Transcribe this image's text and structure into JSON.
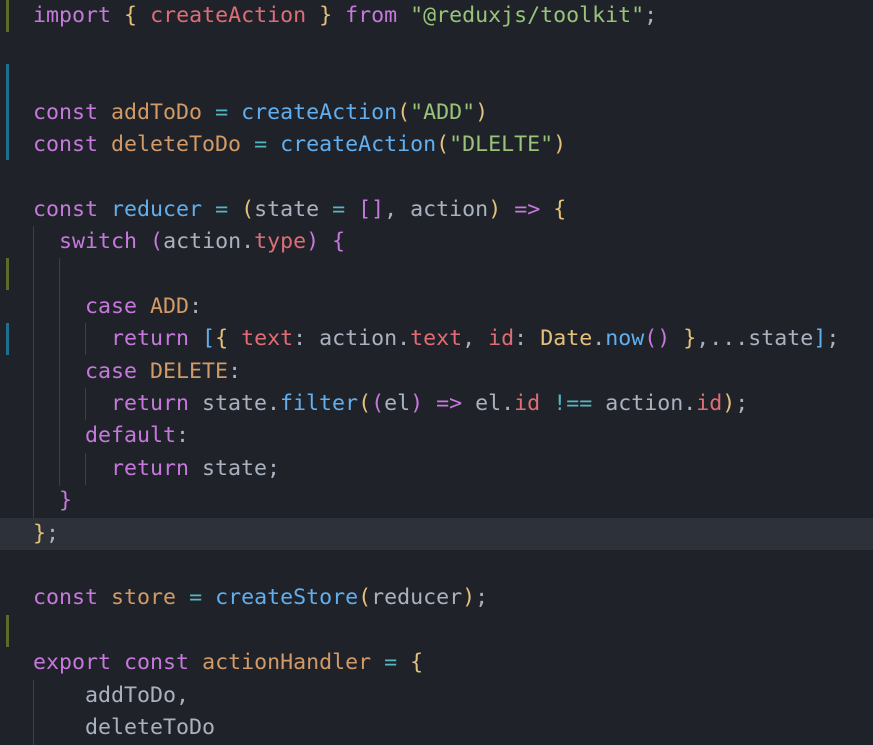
{
  "editor": {
    "language": "javascript",
    "colors": {
      "background": "#1f2329",
      "current_line": "#2c313a",
      "gutter_modified": "#5b6b2a",
      "gutter_added": "#1e6e8c",
      "keyword": "#c678dd",
      "function": "#61afef",
      "string": "#98c379",
      "variable": "#d19a66",
      "property": "#e06c75",
      "punctuation": "#abb2bf"
    },
    "lines": [
      [
        [
          "k",
          "import"
        ],
        [
          "p",
          " "
        ],
        [
          "b",
          "{"
        ],
        [
          "p",
          " "
        ],
        [
          "i",
          "createAction"
        ],
        [
          "p",
          " "
        ],
        [
          "b",
          "}"
        ],
        [
          "p",
          " "
        ],
        [
          "k",
          "from"
        ],
        [
          "p",
          " "
        ],
        [
          "s",
          "\"@reduxjs/toolkit\""
        ],
        [
          "p",
          ";"
        ]
      ],
      [],
      [],
      [
        [
          "k",
          "const"
        ],
        [
          "p",
          " "
        ],
        [
          "var",
          "addToDo"
        ],
        [
          "p",
          " "
        ],
        [
          "o",
          "="
        ],
        [
          "p",
          " "
        ],
        [
          "f",
          "createAction"
        ],
        [
          "b",
          "("
        ],
        [
          "s",
          "\"ADD\""
        ],
        [
          "b",
          ")"
        ]
      ],
      [
        [
          "k",
          "const"
        ],
        [
          "p",
          " "
        ],
        [
          "var",
          "deleteToDo"
        ],
        [
          "p",
          " "
        ],
        [
          "o",
          "="
        ],
        [
          "p",
          " "
        ],
        [
          "f",
          "createAction"
        ],
        [
          "b",
          "("
        ],
        [
          "s",
          "\"DLELTE\""
        ],
        [
          "b",
          ")"
        ]
      ],
      [],
      [
        [
          "k",
          "const"
        ],
        [
          "p",
          " "
        ],
        [
          "f",
          "reducer"
        ],
        [
          "p",
          " "
        ],
        [
          "o",
          "="
        ],
        [
          "p",
          " "
        ],
        [
          "b",
          "("
        ],
        [
          "p",
          "state "
        ],
        [
          "o",
          "="
        ],
        [
          "p",
          " "
        ],
        [
          "k",
          "[]"
        ],
        [
          "p",
          ", action"
        ],
        [
          "b",
          ")"
        ],
        [
          "p",
          " "
        ],
        [
          "k",
          "=>"
        ],
        [
          "p",
          " "
        ],
        [
          "b",
          "{"
        ]
      ],
      [
        [
          "p",
          "  "
        ],
        [
          "k",
          "switch"
        ],
        [
          "p",
          " "
        ],
        [
          "k",
          "("
        ],
        [
          "p",
          "action."
        ],
        [
          "i",
          "type"
        ],
        [
          "k",
          ")"
        ],
        [
          "p",
          " "
        ],
        [
          "k",
          "{"
        ]
      ],
      [],
      [
        [
          "p",
          "    "
        ],
        [
          "k",
          "case"
        ],
        [
          "p",
          " "
        ],
        [
          "var",
          "ADD"
        ],
        [
          "p",
          ":"
        ]
      ],
      [
        [
          "p",
          "      "
        ],
        [
          "k",
          "return"
        ],
        [
          "p",
          " "
        ],
        [
          "f",
          "["
        ],
        [
          "b",
          "{"
        ],
        [
          "p",
          " "
        ],
        [
          "i",
          "text"
        ],
        [
          "p",
          ": action."
        ],
        [
          "i",
          "text"
        ],
        [
          "p",
          ", "
        ],
        [
          "i",
          "id"
        ],
        [
          "p",
          ": "
        ],
        [
          "t",
          "Date"
        ],
        [
          "p",
          "."
        ],
        [
          "f",
          "now"
        ],
        [
          "k",
          "()"
        ],
        [
          "p",
          " "
        ],
        [
          "b",
          "}"
        ],
        [
          "p",
          ",..."
        ],
        [
          "p",
          "state"
        ],
        [
          "f",
          "]"
        ],
        [
          "p",
          ";"
        ]
      ],
      [
        [
          "p",
          "    "
        ],
        [
          "k",
          "case"
        ],
        [
          "p",
          " "
        ],
        [
          "var",
          "DELETE"
        ],
        [
          "p",
          ":"
        ]
      ],
      [
        [
          "p",
          "      "
        ],
        [
          "k",
          "return"
        ],
        [
          "p",
          " state."
        ],
        [
          "f",
          "filter"
        ],
        [
          "b",
          "("
        ],
        [
          "k",
          "("
        ],
        [
          "p",
          "el"
        ],
        [
          "k",
          ")"
        ],
        [
          "p",
          " "
        ],
        [
          "k",
          "=>"
        ],
        [
          "p",
          " el."
        ],
        [
          "i",
          "id"
        ],
        [
          "p",
          " "
        ],
        [
          "o",
          "!=="
        ],
        [
          "p",
          " action."
        ],
        [
          "i",
          "id"
        ],
        [
          "b",
          ")"
        ],
        [
          "p",
          ";"
        ]
      ],
      [
        [
          "p",
          "    "
        ],
        [
          "k",
          "default"
        ],
        [
          "p",
          ":"
        ]
      ],
      [
        [
          "p",
          "      "
        ],
        [
          "k",
          "return"
        ],
        [
          "p",
          " state;"
        ]
      ],
      [
        [
          "p",
          "  "
        ],
        [
          "k",
          "}"
        ]
      ],
      [
        [
          "b",
          "}"
        ],
        [
          "p",
          ";"
        ]
      ],
      [],
      [
        [
          "k",
          "const"
        ],
        [
          "p",
          " "
        ],
        [
          "var",
          "store"
        ],
        [
          "p",
          " "
        ],
        [
          "o",
          "="
        ],
        [
          "p",
          " "
        ],
        [
          "f",
          "createStore"
        ],
        [
          "b",
          "("
        ],
        [
          "p",
          "reducer"
        ],
        [
          "b",
          ")"
        ],
        [
          "p",
          ";"
        ]
      ],
      [],
      [
        [
          "k",
          "export"
        ],
        [
          "p",
          " "
        ],
        [
          "k",
          "const"
        ],
        [
          "p",
          " "
        ],
        [
          "var",
          "actionHandler"
        ],
        [
          "p",
          " "
        ],
        [
          "o",
          "="
        ],
        [
          "p",
          " "
        ],
        [
          "b",
          "{"
        ]
      ],
      [
        [
          "p",
          "    addToDo,"
        ]
      ],
      [
        [
          "p",
          "    deleteToDo"
        ]
      ]
    ],
    "current_line_index": 16
  }
}
